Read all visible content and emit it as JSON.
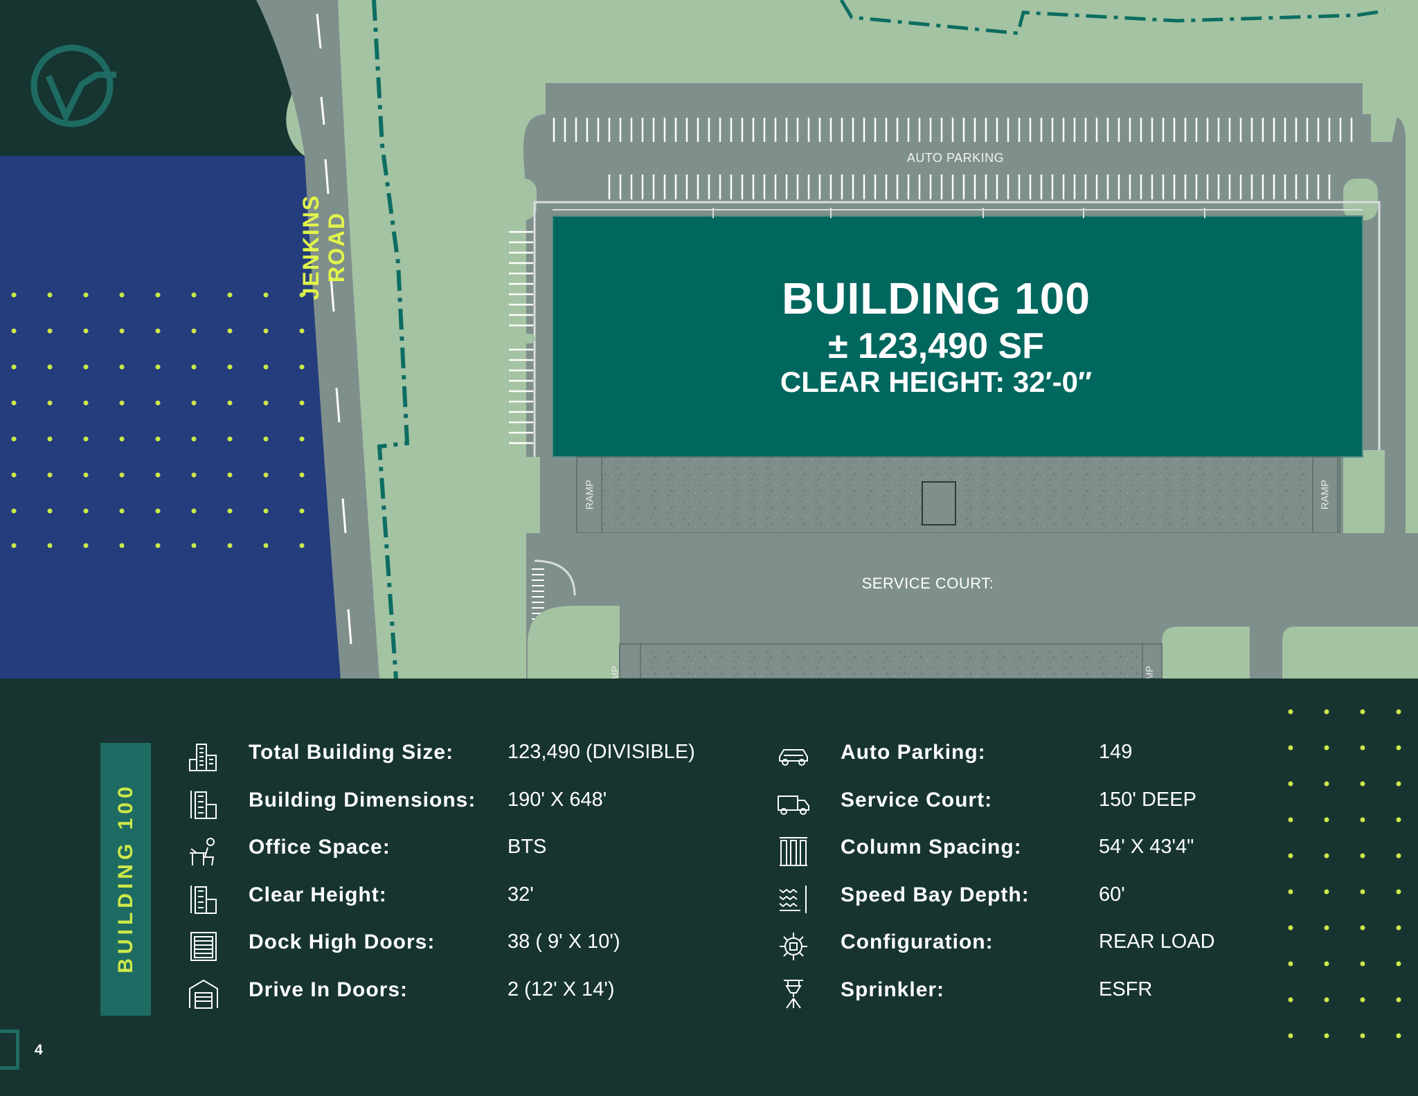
{
  "map": {
    "building_title": "BUILDING 100",
    "building_sf": "± 123,490 SF",
    "building_clear_height": "CLEAR HEIGHT: 32′-0″",
    "road_name": "JENKINS ROAD",
    "auto_parking_label": "AUTO PARKING",
    "service_court_label": "SERVICE COURT:",
    "ramp_label": "RAMP",
    "ramp_partial_left": "MP",
    "ramp_partial_right": "MP"
  },
  "colors": {
    "info_background": "#173430",
    "building_fill": "#00675f",
    "grass": "#a4c3a3",
    "pavement": "#7f8f8c",
    "water_block": "#253d7d",
    "accent_green": "#cde84a",
    "tab_fill": "#1e6b63"
  },
  "side_tab": {
    "label": "BUILDING 100"
  },
  "specs_left": [
    {
      "icon": "building-size-icon",
      "label": "Total Building Size:",
      "value": "123,490 (DIVISIBLE)"
    },
    {
      "icon": "building-dimensions-icon",
      "label": "Building Dimensions:",
      "value": "190' X 648'"
    },
    {
      "icon": "office-desk-icon",
      "label": "Office Space:",
      "value": "BTS"
    },
    {
      "icon": "clear-height-icon",
      "label": "Clear Height:",
      "value": "32'"
    },
    {
      "icon": "dock-door-icon",
      "label": "Dock High Doors:",
      "value": "38 ( 9' X 10')"
    },
    {
      "icon": "drive-in-door-icon",
      "label": "Drive In Doors:",
      "value": "2 (12' X 14')"
    }
  ],
  "specs_right": [
    {
      "icon": "car-icon",
      "label": "Auto Parking:",
      "value": "149"
    },
    {
      "icon": "truck-icon",
      "label": "Service Court:",
      "value": "150' DEEP"
    },
    {
      "icon": "columns-icon",
      "label": "Column Spacing:",
      "value": "54' X 43'4\""
    },
    {
      "icon": "speed-bay-icon",
      "label": "Speed Bay Depth:",
      "value": "60'"
    },
    {
      "icon": "gear-icon",
      "label": "Configuration:",
      "value": "REAR LOAD"
    },
    {
      "icon": "sprinkler-icon",
      "label": "Sprinkler:",
      "value": "ESFR"
    }
  ],
  "page_number": "4"
}
